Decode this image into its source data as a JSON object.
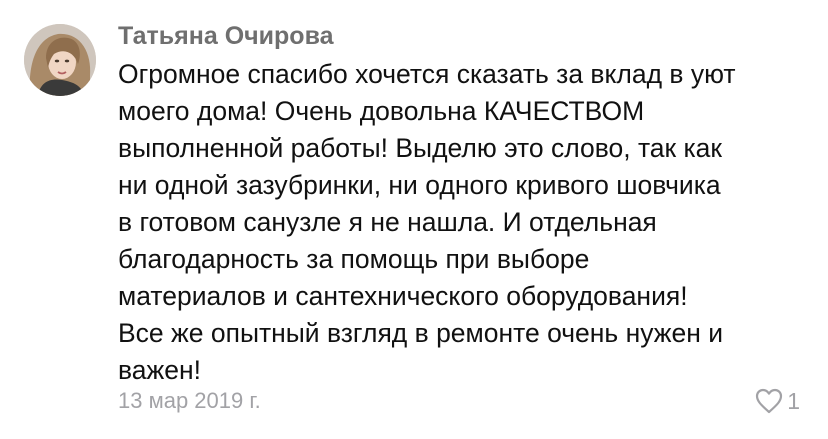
{
  "comment": {
    "author": "Татьяна Очирова",
    "text_lines": [
      "Огромное спасибо хочется сказать за вклад в уют",
      "моего дома! Очень довольна КАЧЕСТВОМ",
      "выполненной работы! Выделю это слово, так как",
      "ни одной зазубринки, ни одного кривого шовчика",
      "в готовом санузле я не нашла. И отдельная",
      "благодарность за помощь при выборе",
      "материалов и сантехнического оборудования!",
      "Все же опытный взгляд в ремонте очень нужен и",
      "важен!"
    ],
    "date": "13 мар 2019 г.",
    "likes": "1"
  },
  "icons": {
    "like": "heart-outline-icon"
  },
  "colors": {
    "author": "#6f6f6f",
    "text": "#111111",
    "meta": "#a2a2a6",
    "background": "#ffffff"
  }
}
